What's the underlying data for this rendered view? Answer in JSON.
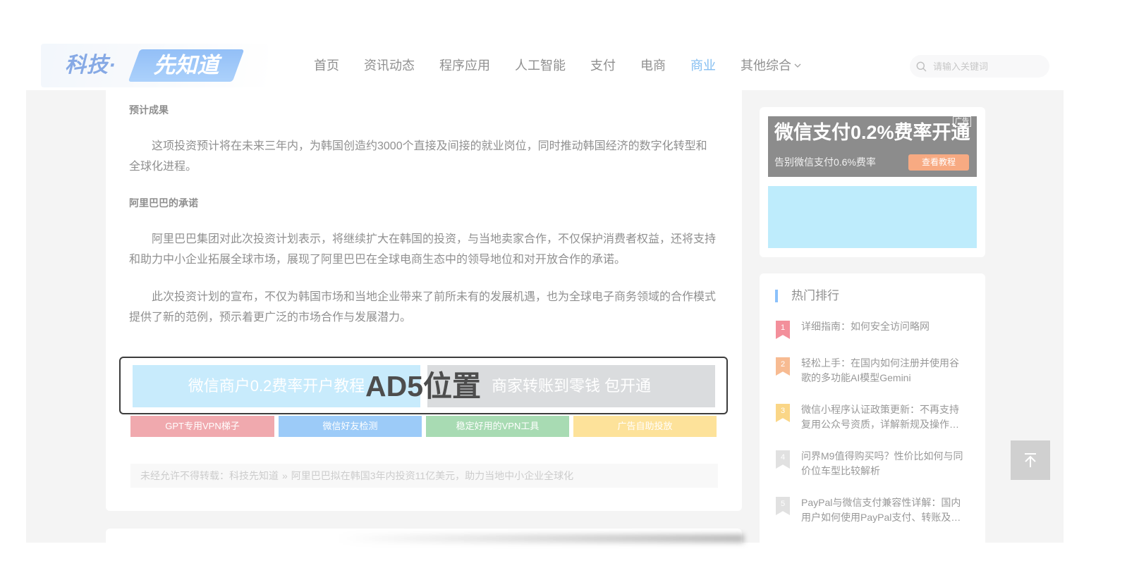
{
  "header": {
    "logo": {
      "prefix": "科技·",
      "name": "先知道"
    },
    "nav": [
      {
        "label": "首页"
      },
      {
        "label": "资讯动态"
      },
      {
        "label": "程序应用"
      },
      {
        "label": "人工智能"
      },
      {
        "label": "支付"
      },
      {
        "label": "电商"
      },
      {
        "label": "商业",
        "active": true
      },
      {
        "label": "其他综合",
        "dropdown": true,
        "icon": "chevron-down-icon"
      }
    ],
    "search": {
      "placeholder": "请输入关键词",
      "icon": "search-icon"
    }
  },
  "article": {
    "sections": [
      {
        "heading": "预计成果",
        "paragraphs": [
          "这项投资预计将在未来三年内，为韩国创造约3000个直接及间接的就业岗位，同时推动韩国经济的数字化转型和全球化进程。"
        ]
      },
      {
        "heading": "阿里巴巴的承诺",
        "paragraphs": [
          "阿里巴巴集团对此次投资计划表示，将继续扩大在韩国的投资，与当地卖家合作，不仅保护消费者权益，还将支持和助力中小企业拓展全球市场，展现了阿里巴巴在全球电商生态中的领导地位和对开放合作的承诺。",
          "此次投资计划的宣布，不仅为韩国市场和当地企业带来了前所未有的发展机遇，也为全球电子商务领域的合作模式提供了新的范例，预示着更广泛的市场合作与发展潜力。"
        ]
      }
    ]
  },
  "ad_slot": {
    "label": "AD5位置",
    "banners": [
      {
        "text": "微信商户0.2费率开户教程",
        "color": "#9bdbfa"
      },
      {
        "text": "商家转账到零钱 包开通",
        "color": "#bcbfc3"
      }
    ]
  },
  "quick_links": [
    {
      "label": "GPT专用VPN梯子",
      "color": "#e4636c"
    },
    {
      "label": "微信好友检测",
      "color": "#4ba0f2"
    },
    {
      "label": "稳定好用的VPN工具",
      "color": "#61be75"
    },
    {
      "label": "广告自助投放",
      "color": "#fbca48"
    }
  ],
  "copyright": {
    "prefix": "未经允许不得转载：",
    "site": "科技先知道",
    "separator": "»",
    "title": "阿里巴巴拟在韩国3年内投资11亿美元，助力当地中小企业全球化"
  },
  "sidebar": {
    "ad": {
      "title": "微信支付0.2%费率开通",
      "tag": "广告",
      "subtitle": "告别微信支付0.6%费率",
      "button": "查看教程",
      "background": "#2e2e2e",
      "button_color": "#f1641c",
      "placeholder_color": "#89ddfa"
    },
    "hot": {
      "title": "热门排行",
      "items": [
        {
          "rank": "1",
          "title": "详细指南：如何安全访问略网",
          "color": "#e93349"
        },
        {
          "rank": "2",
          "title": "轻松上手：在国内如何注册并使用谷歌的多功能AI模型Gemini",
          "color": "#f0833a"
        },
        {
          "rank": "3",
          "title": "微信小程序认证政策更新：不再支持复用公众号资质，详解新规及操作…",
          "color": "#f6b425"
        },
        {
          "rank": "4",
          "title": "问界M9值得购买吗？性价比如何与同价位车型比较解析",
          "color": "#c8c8c8"
        },
        {
          "rank": "5",
          "title": "PayPal与微信支付兼容性详解：国内用户如何使用PayPal支付、转账及…",
          "color": "#c8c8c8"
        }
      ]
    }
  },
  "back_to_top": {
    "icon": "arrow-up-to-top-icon"
  },
  "colors": {
    "accent": "#2c8ef8",
    "active_nav": "#1e88e5",
    "overlay": "rgba(255,255,255,0.45)",
    "ad_box_border": "#3c3c3c"
  }
}
